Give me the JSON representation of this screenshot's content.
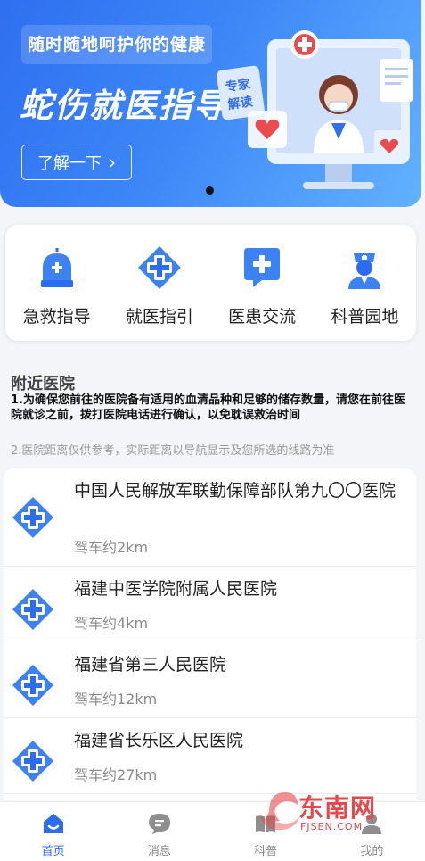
{
  "banner": {
    "slogan": "随时随地呵护你的健康",
    "title": "蛇伤就医指导",
    "more_label": "了解一下",
    "expert_sign": "专家解读"
  },
  "menu": {
    "items": [
      {
        "label": "急救指导",
        "icon": "siren-icon"
      },
      {
        "label": "就医指引",
        "icon": "medical-cross-icon"
      },
      {
        "label": "医患交流",
        "icon": "chat-cross-icon"
      },
      {
        "label": "科普园地",
        "icon": "nurse-icon"
      }
    ]
  },
  "nearby": {
    "title": "附近医院",
    "note1": "1.为确保您前往的医院备有适用的血清品种和足够的储存数量，请您在前往医院就诊之前，拨打医院电话进行确认，以免耽误救治时间",
    "note2": "2.医院距离仅供参考，实际距离以导航显示及您所选的线路为准",
    "hospitals": [
      {
        "name": "中国人民解放军联勤保障部队第九〇〇医院",
        "distance": "驾车约2km"
      },
      {
        "name": "福建中医学院附属人民医院",
        "distance": "驾车约4km"
      },
      {
        "name": "福建省第三人民医院",
        "distance": "驾车约12km"
      },
      {
        "name": "福建省长乐区人民医院",
        "distance": "驾车约27km"
      }
    ]
  },
  "tabbar": {
    "tabs": [
      {
        "label": "首页",
        "active": true
      },
      {
        "label": "消息",
        "active": false
      },
      {
        "label": "科普",
        "active": false
      },
      {
        "label": "我的",
        "active": false
      }
    ]
  },
  "watermark": {
    "name": "东南网",
    "domain": "FJSEN.COM"
  },
  "colors": {
    "primary": "#2c6df0",
    "banner_start": "#2f6ff0",
    "banner_end": "#62b2ff"
  }
}
